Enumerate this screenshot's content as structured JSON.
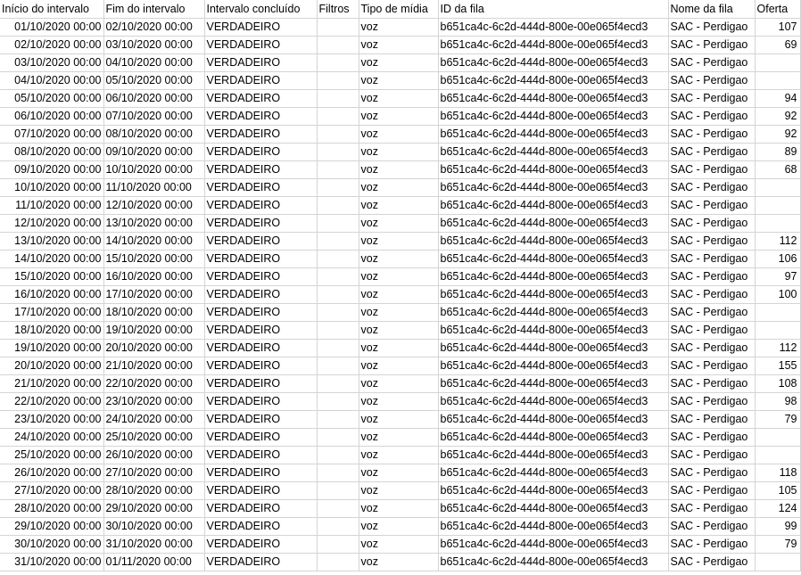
{
  "columns": [
    "Início do intervalo",
    "Fim do intervalo",
    "Intervalo concluído",
    "Filtros",
    "Tipo de mídia",
    "ID da fila",
    "Nome da fila",
    "Oferta"
  ],
  "rows": [
    {
      "start": "01/10/2020 00:00",
      "end": "02/10/2020 00:00",
      "done": "VERDADEIRO",
      "filter": "",
      "media": "voz",
      "id": "b651ca4c-6c2d-444d-800e-00e065f4ecd3",
      "name": "SAC - Perdigao",
      "offer": "107"
    },
    {
      "start": "02/10/2020 00:00",
      "end": "03/10/2020 00:00",
      "done": "VERDADEIRO",
      "filter": "",
      "media": "voz",
      "id": "b651ca4c-6c2d-444d-800e-00e065f4ecd3",
      "name": "SAC - Perdigao",
      "offer": "69"
    },
    {
      "start": "03/10/2020 00:00",
      "end": "04/10/2020 00:00",
      "done": "VERDADEIRO",
      "filter": "",
      "media": "voz",
      "id": "b651ca4c-6c2d-444d-800e-00e065f4ecd3",
      "name": "SAC - Perdigao",
      "offer": ""
    },
    {
      "start": "04/10/2020 00:00",
      "end": "05/10/2020 00:00",
      "done": "VERDADEIRO",
      "filter": "",
      "media": "voz",
      "id": "b651ca4c-6c2d-444d-800e-00e065f4ecd3",
      "name": "SAC - Perdigao",
      "offer": ""
    },
    {
      "start": "05/10/2020 00:00",
      "end": "06/10/2020 00:00",
      "done": "VERDADEIRO",
      "filter": "",
      "media": "voz",
      "id": "b651ca4c-6c2d-444d-800e-00e065f4ecd3",
      "name": "SAC - Perdigao",
      "offer": "94"
    },
    {
      "start": "06/10/2020 00:00",
      "end": "07/10/2020 00:00",
      "done": "VERDADEIRO",
      "filter": "",
      "media": "voz",
      "id": "b651ca4c-6c2d-444d-800e-00e065f4ecd3",
      "name": "SAC - Perdigao",
      "offer": "92"
    },
    {
      "start": "07/10/2020 00:00",
      "end": "08/10/2020 00:00",
      "done": "VERDADEIRO",
      "filter": "",
      "media": "voz",
      "id": "b651ca4c-6c2d-444d-800e-00e065f4ecd3",
      "name": "SAC - Perdigao",
      "offer": "92"
    },
    {
      "start": "08/10/2020 00:00",
      "end": "09/10/2020 00:00",
      "done": "VERDADEIRO",
      "filter": "",
      "media": "voz",
      "id": "b651ca4c-6c2d-444d-800e-00e065f4ecd3",
      "name": "SAC - Perdigao",
      "offer": "89"
    },
    {
      "start": "09/10/2020 00:00",
      "end": "10/10/2020 00:00",
      "done": "VERDADEIRO",
      "filter": "",
      "media": "voz",
      "id": "b651ca4c-6c2d-444d-800e-00e065f4ecd3",
      "name": "SAC - Perdigao",
      "offer": "68"
    },
    {
      "start": "10/10/2020 00:00",
      "end": "11/10/2020 00:00",
      "done": "VERDADEIRO",
      "filter": "",
      "media": "voz",
      "id": "b651ca4c-6c2d-444d-800e-00e065f4ecd3",
      "name": "SAC - Perdigao",
      "offer": ""
    },
    {
      "start": "11/10/2020 00:00",
      "end": "12/10/2020 00:00",
      "done": "VERDADEIRO",
      "filter": "",
      "media": "voz",
      "id": "b651ca4c-6c2d-444d-800e-00e065f4ecd3",
      "name": "SAC - Perdigao",
      "offer": ""
    },
    {
      "start": "12/10/2020 00:00",
      "end": "13/10/2020 00:00",
      "done": "VERDADEIRO",
      "filter": "",
      "media": "voz",
      "id": "b651ca4c-6c2d-444d-800e-00e065f4ecd3",
      "name": "SAC - Perdigao",
      "offer": ""
    },
    {
      "start": "13/10/2020 00:00",
      "end": "14/10/2020 00:00",
      "done": "VERDADEIRO",
      "filter": "",
      "media": "voz",
      "id": "b651ca4c-6c2d-444d-800e-00e065f4ecd3",
      "name": "SAC - Perdigao",
      "offer": "112"
    },
    {
      "start": "14/10/2020 00:00",
      "end": "15/10/2020 00:00",
      "done": "VERDADEIRO",
      "filter": "",
      "media": "voz",
      "id": "b651ca4c-6c2d-444d-800e-00e065f4ecd3",
      "name": "SAC - Perdigao",
      "offer": "106"
    },
    {
      "start": "15/10/2020 00:00",
      "end": "16/10/2020 00:00",
      "done": "VERDADEIRO",
      "filter": "",
      "media": "voz",
      "id": "b651ca4c-6c2d-444d-800e-00e065f4ecd3",
      "name": "SAC - Perdigao",
      "offer": "97"
    },
    {
      "start": "16/10/2020 00:00",
      "end": "17/10/2020 00:00",
      "done": "VERDADEIRO",
      "filter": "",
      "media": "voz",
      "id": "b651ca4c-6c2d-444d-800e-00e065f4ecd3",
      "name": "SAC - Perdigao",
      "offer": "100"
    },
    {
      "start": "17/10/2020 00:00",
      "end": "18/10/2020 00:00",
      "done": "VERDADEIRO",
      "filter": "",
      "media": "voz",
      "id": "b651ca4c-6c2d-444d-800e-00e065f4ecd3",
      "name": "SAC - Perdigao",
      "offer": ""
    },
    {
      "start": "18/10/2020 00:00",
      "end": "19/10/2020 00:00",
      "done": "VERDADEIRO",
      "filter": "",
      "media": "voz",
      "id": "b651ca4c-6c2d-444d-800e-00e065f4ecd3",
      "name": "SAC - Perdigao",
      "offer": ""
    },
    {
      "start": "19/10/2020 00:00",
      "end": "20/10/2020 00:00",
      "done": "VERDADEIRO",
      "filter": "",
      "media": "voz",
      "id": "b651ca4c-6c2d-444d-800e-00e065f4ecd3",
      "name": "SAC - Perdigao",
      "offer": "112"
    },
    {
      "start": "20/10/2020 00:00",
      "end": "21/10/2020 00:00",
      "done": "VERDADEIRO",
      "filter": "",
      "media": "voz",
      "id": "b651ca4c-6c2d-444d-800e-00e065f4ecd3",
      "name": "SAC - Perdigao",
      "offer": "155"
    },
    {
      "start": "21/10/2020 00:00",
      "end": "22/10/2020 00:00",
      "done": "VERDADEIRO",
      "filter": "",
      "media": "voz",
      "id": "b651ca4c-6c2d-444d-800e-00e065f4ecd3",
      "name": "SAC - Perdigao",
      "offer": "108"
    },
    {
      "start": "22/10/2020 00:00",
      "end": "23/10/2020 00:00",
      "done": "VERDADEIRO",
      "filter": "",
      "media": "voz",
      "id": "b651ca4c-6c2d-444d-800e-00e065f4ecd3",
      "name": "SAC - Perdigao",
      "offer": "98"
    },
    {
      "start": "23/10/2020 00:00",
      "end": "24/10/2020 00:00",
      "done": "VERDADEIRO",
      "filter": "",
      "media": "voz",
      "id": "b651ca4c-6c2d-444d-800e-00e065f4ecd3",
      "name": "SAC - Perdigao",
      "offer": "79"
    },
    {
      "start": "24/10/2020 00:00",
      "end": "25/10/2020 00:00",
      "done": "VERDADEIRO",
      "filter": "",
      "media": "voz",
      "id": "b651ca4c-6c2d-444d-800e-00e065f4ecd3",
      "name": "SAC - Perdigao",
      "offer": ""
    },
    {
      "start": "25/10/2020 00:00",
      "end": "26/10/2020 00:00",
      "done": "VERDADEIRO",
      "filter": "",
      "media": "voz",
      "id": "b651ca4c-6c2d-444d-800e-00e065f4ecd3",
      "name": "SAC - Perdigao",
      "offer": ""
    },
    {
      "start": "26/10/2020 00:00",
      "end": "27/10/2020 00:00",
      "done": "VERDADEIRO",
      "filter": "",
      "media": "voz",
      "id": "b651ca4c-6c2d-444d-800e-00e065f4ecd3",
      "name": "SAC - Perdigao",
      "offer": "118"
    },
    {
      "start": "27/10/2020 00:00",
      "end": "28/10/2020 00:00",
      "done": "VERDADEIRO",
      "filter": "",
      "media": "voz",
      "id": "b651ca4c-6c2d-444d-800e-00e065f4ecd3",
      "name": "SAC - Perdigao",
      "offer": "105"
    },
    {
      "start": "28/10/2020 00:00",
      "end": "29/10/2020 00:00",
      "done": "VERDADEIRO",
      "filter": "",
      "media": "voz",
      "id": "b651ca4c-6c2d-444d-800e-00e065f4ecd3",
      "name": "SAC - Perdigao",
      "offer": "124"
    },
    {
      "start": "29/10/2020 00:00",
      "end": "30/10/2020 00:00",
      "done": "VERDADEIRO",
      "filter": "",
      "media": "voz",
      "id": "b651ca4c-6c2d-444d-800e-00e065f4ecd3",
      "name": "SAC - Perdigao",
      "offer": "99"
    },
    {
      "start": "30/10/2020 00:00",
      "end": "31/10/2020 00:00",
      "done": "VERDADEIRO",
      "filter": "",
      "media": "voz",
      "id": "b651ca4c-6c2d-444d-800e-00e065f4ecd3",
      "name": "SAC - Perdigao",
      "offer": "79"
    },
    {
      "start": "31/10/2020 00:00",
      "end": "01/11/2020 00:00",
      "done": "VERDADEIRO",
      "filter": "",
      "media": "voz",
      "id": "b651ca4c-6c2d-444d-800e-00e065f4ecd3",
      "name": "SAC - Perdigao",
      "offer": ""
    }
  ]
}
